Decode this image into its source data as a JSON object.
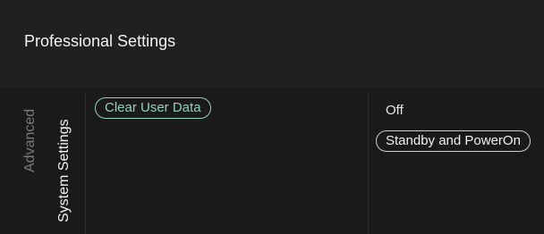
{
  "header": {
    "title": "Professional Settings"
  },
  "tabs": [
    {
      "label": "Advanced",
      "selected": false
    },
    {
      "label": "System Settings",
      "selected": true
    }
  ],
  "menu": {
    "items": [
      {
        "label": "Clear User Data",
        "focused": true
      }
    ]
  },
  "options": {
    "items": [
      {
        "label": "Off",
        "selected": false
      },
      {
        "label": "Standby and PowerOn",
        "selected": true
      }
    ]
  },
  "colors": {
    "background": "#1c1c1c",
    "header_background": "#202020",
    "accent": "#8fd1c2",
    "text": "#f2f2f2",
    "muted_text": "#7a7a7a"
  }
}
